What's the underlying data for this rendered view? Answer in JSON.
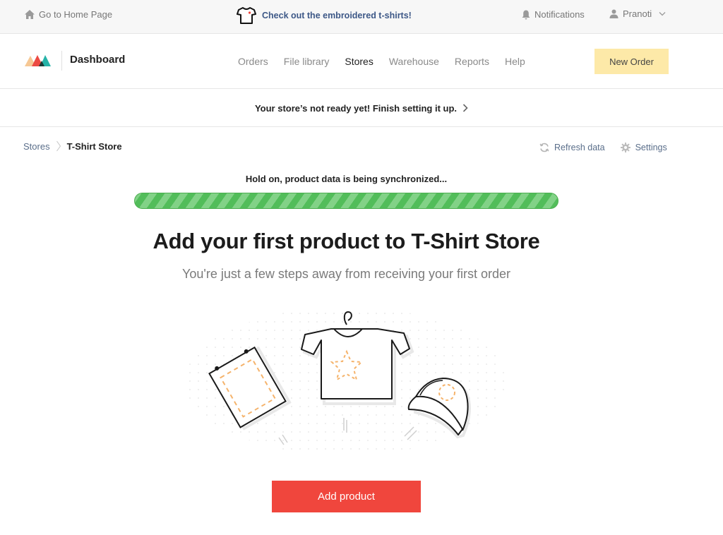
{
  "topbar": {
    "home_label": "Go to Home Page",
    "promo_label": "Check out the embroidered t-shirts!",
    "notifications_label": "Notifications",
    "user_name": "Pranoti"
  },
  "nav": {
    "brand": "Dashboard",
    "links": [
      {
        "label": "Orders",
        "active": false
      },
      {
        "label": "File library",
        "active": false
      },
      {
        "label": "Stores",
        "active": true
      },
      {
        "label": "Warehouse",
        "active": false
      },
      {
        "label": "Reports",
        "active": false
      },
      {
        "label": "Help",
        "active": false
      }
    ],
    "new_order_label": "New Order"
  },
  "banner": {
    "text": "Your store’s not ready yet! Finish setting it up."
  },
  "breadcrumb": {
    "parent": "Stores",
    "current": "T-Shirt Store"
  },
  "actions": {
    "refresh_label": "Refresh data",
    "settings_label": "Settings"
  },
  "sync": {
    "message": "Hold on, product data is being synchronized...",
    "progress_percent": 100
  },
  "main": {
    "title": "Add your first product to T-Shirt Store",
    "subtitle": "You're just a few steps away from receiving your first order",
    "add_product_label": "Add product"
  },
  "colors": {
    "primary_cta": "#f0463d",
    "new_order_bg": "#fde9a8",
    "progress_green": "#52bd5a",
    "link_blue": "#3d5887",
    "illustration_accent": "#f5b36b"
  }
}
